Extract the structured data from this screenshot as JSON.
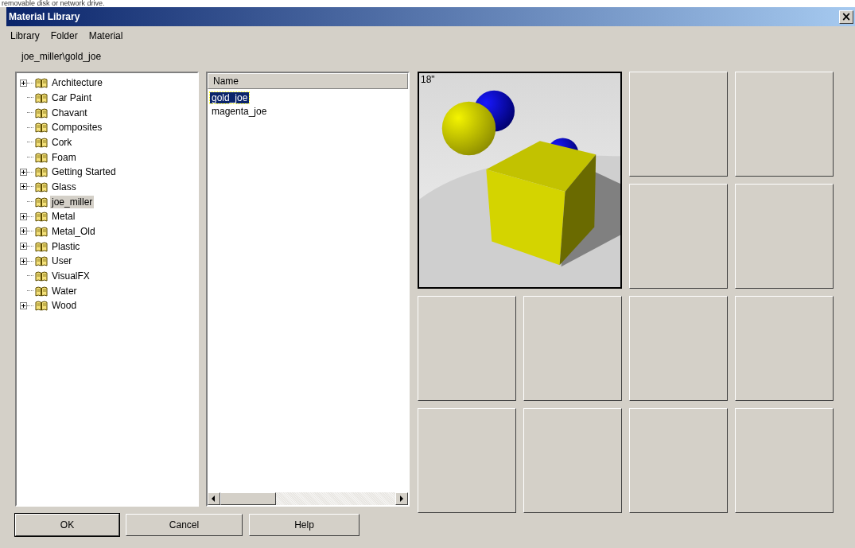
{
  "top_caption": "removable disk or network drive.",
  "window": {
    "title": "Material Library",
    "close_glyph": "×"
  },
  "menu": [
    {
      "label": "Library"
    },
    {
      "label": "Folder"
    },
    {
      "label": "Material"
    }
  ],
  "path": "joe_miller\\gold_joe",
  "tree": [
    {
      "label": "Architecture",
      "expandable": true,
      "selected": false
    },
    {
      "label": "Car Paint",
      "expandable": false,
      "selected": false
    },
    {
      "label": "Chavant",
      "expandable": false,
      "selected": false
    },
    {
      "label": "Composites",
      "expandable": false,
      "selected": false
    },
    {
      "label": "Cork",
      "expandable": false,
      "selected": false
    },
    {
      "label": "Foam",
      "expandable": false,
      "selected": false
    },
    {
      "label": "Getting Started",
      "expandable": true,
      "selected": false
    },
    {
      "label": "Glass",
      "expandable": true,
      "selected": false
    },
    {
      "label": "joe_miller",
      "expandable": false,
      "selected": true
    },
    {
      "label": "Metal",
      "expandable": true,
      "selected": false
    },
    {
      "label": "Metal_Old",
      "expandable": true,
      "selected": false
    },
    {
      "label": "Plastic",
      "expandable": true,
      "selected": false
    },
    {
      "label": "User",
      "expandable": true,
      "selected": false
    },
    {
      "label": "VisualFX",
      "expandable": false,
      "selected": false
    },
    {
      "label": "Water",
      "expandable": false,
      "selected": false
    },
    {
      "label": "Wood",
      "expandable": true,
      "selected": false
    }
  ],
  "list": {
    "columns": [
      "Name"
    ],
    "rows": [
      {
        "name": "gold_joe",
        "selected": true
      },
      {
        "name": "magenta_joe",
        "selected": false
      }
    ]
  },
  "tiles": [
    {
      "kind": "preview",
      "label": "18\"",
      "selected": true
    },
    {
      "kind": "empty"
    },
    {
      "kind": "empty"
    },
    {
      "kind": "empty"
    },
    {
      "kind": "empty"
    },
    {
      "kind": "empty"
    },
    {
      "kind": "empty"
    },
    {
      "kind": "empty"
    },
    {
      "kind": "empty"
    },
    {
      "kind": "empty"
    },
    {
      "kind": "empty"
    },
    {
      "kind": "empty"
    },
    {
      "kind": "empty"
    }
  ],
  "buttons": [
    {
      "label": "OK",
      "default": true
    },
    {
      "label": "Cancel",
      "default": false
    },
    {
      "label": "Help",
      "default": false
    }
  ]
}
